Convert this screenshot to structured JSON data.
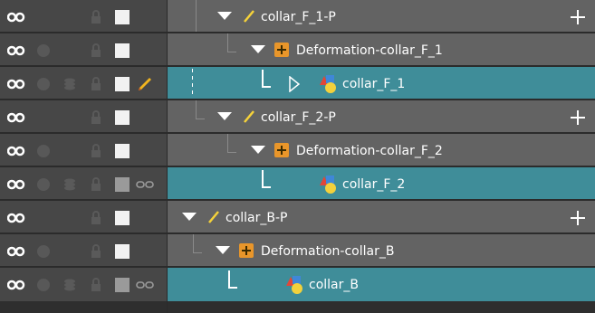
{
  "layers": [
    {
      "name": "collar_F_1-P",
      "type": "peg",
      "selected": false,
      "has_plus": true
    },
    {
      "name": "Deformation-collar_F_1",
      "type": "deformation",
      "selected": false,
      "has_plus": false
    },
    {
      "name": "collar_F_1",
      "type": "drawing",
      "selected": true,
      "has_plus": false
    },
    {
      "name": "collar_F_2-P",
      "type": "peg",
      "selected": false,
      "has_plus": true
    },
    {
      "name": "Deformation-collar_F_2",
      "type": "deformation",
      "selected": false,
      "has_plus": false
    },
    {
      "name": "collar_F_2",
      "type": "drawing",
      "selected": true,
      "has_plus": false
    },
    {
      "name": "collar_B-P",
      "type": "peg",
      "selected": false,
      "has_plus": true
    },
    {
      "name": "Deformation-collar_B",
      "type": "deformation",
      "selected": false,
      "has_plus": false
    },
    {
      "name": "collar_B",
      "type": "drawing",
      "selected": true,
      "has_plus": false
    }
  ],
  "colors": {
    "row_bg": "#636363",
    "control_bg": "#474747",
    "selected_bg": "#3f8d99",
    "peg_icon": "#f5d23a",
    "deform_icon": "#e9962a"
  }
}
